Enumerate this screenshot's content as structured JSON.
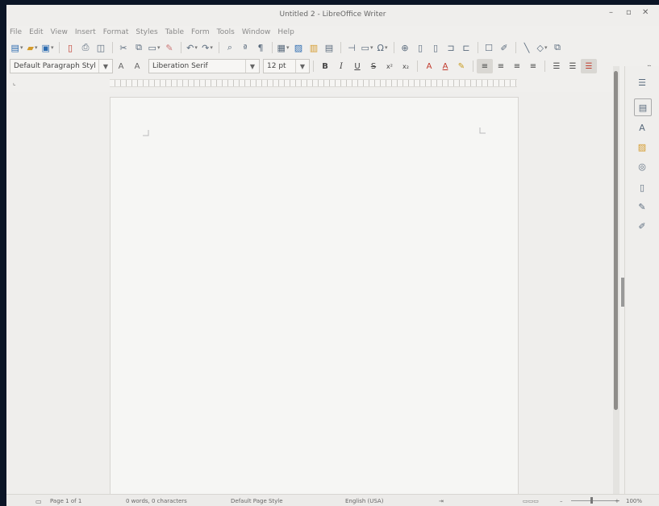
{
  "window": {
    "title": "Untitled 2 - LibreOffice Writer",
    "controls": [
      "–",
      "▫",
      "✕"
    ]
  },
  "menubar": {
    "items": [
      "File",
      "Edit",
      "View",
      "Insert",
      "Format",
      "Styles",
      "Table",
      "Form",
      "Tools",
      "Window",
      "Help"
    ]
  },
  "formatting": {
    "paragraph_style": "Default Paragraph Styl",
    "font_name": "Liberation Serif",
    "font_size": "12 pt",
    "bold": "B",
    "italic": "I",
    "underline": "U",
    "strikethrough": "S",
    "superscript": "x²",
    "subscript": "x₂"
  },
  "sidebar": {
    "expand_label": "»"
  },
  "statusbar": {
    "page": "Page 1 of 1",
    "words": "0 words, 0 characters",
    "page_style": "Default Page Style",
    "language": "English (USA)",
    "zoom": "100%"
  },
  "colors": {
    "accent": "#2b6bb0",
    "font_color": "#c0392b",
    "highlight": "#f2d34a"
  }
}
